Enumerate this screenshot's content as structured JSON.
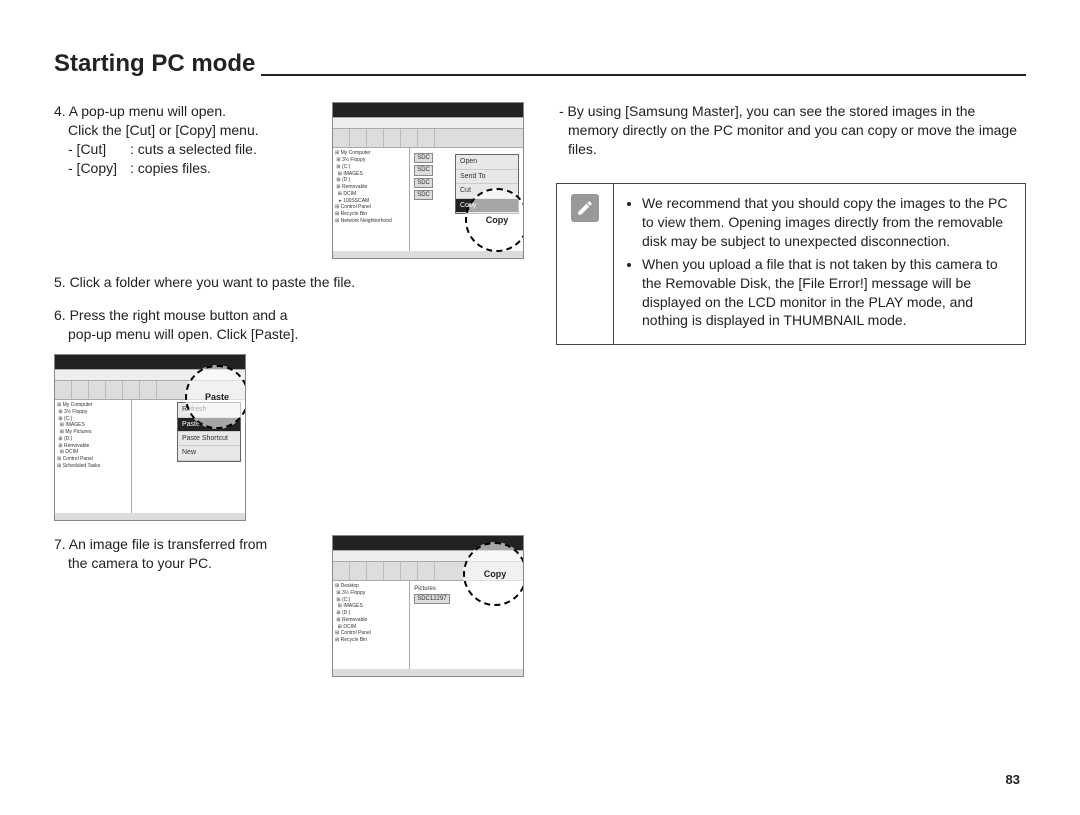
{
  "title": "Starting PC mode",
  "page_number": "83",
  "left": {
    "step4": {
      "lead": "4. A pop-up menu will open.",
      "instr": "Click the [Cut] or [Copy] menu.",
      "cut_key": "- [Cut]",
      "cut_desc": ": cuts a selected file.",
      "copy_key": "- [Copy]",
      "copy_desc": ": copies files.",
      "callout": "Copy",
      "menu": {
        "open": "Open",
        "send_to": "Send To",
        "cut": "Cut",
        "copy": "Copy"
      }
    },
    "step5": "5. Click a folder where you want to paste the file.",
    "step6": {
      "lead": "6. Press the right mouse button and a",
      "cont": "pop-up menu will open. Click [Paste].",
      "callout": "Paste",
      "menu": {
        "refresh": "Refresh",
        "paste": "Paste",
        "paste_shortcut": "Paste Shortcut",
        "new": "New"
      }
    },
    "step7": {
      "lead": "7. An image file is transferred from",
      "cont": "the camera to your PC.",
      "callout": "Copy",
      "chip": "SDC12297"
    }
  },
  "right": {
    "intro": "- By using [Samsung Master], you can see the stored images in the memory directly on the PC monitor and you can copy or move the image files.",
    "notes": {
      "n1": "We recommend that you should copy the images to the PC to view them. Opening images directly from the removable disk may be subject to unexpected disconnection.",
      "n2": "When you upload a file that is not taken by this camera to the Removable Disk, the [File Error!] message will be displayed on the LCD monitor in the PLAY mode, and nothing is displayed in THUMBNAIL mode."
    }
  }
}
